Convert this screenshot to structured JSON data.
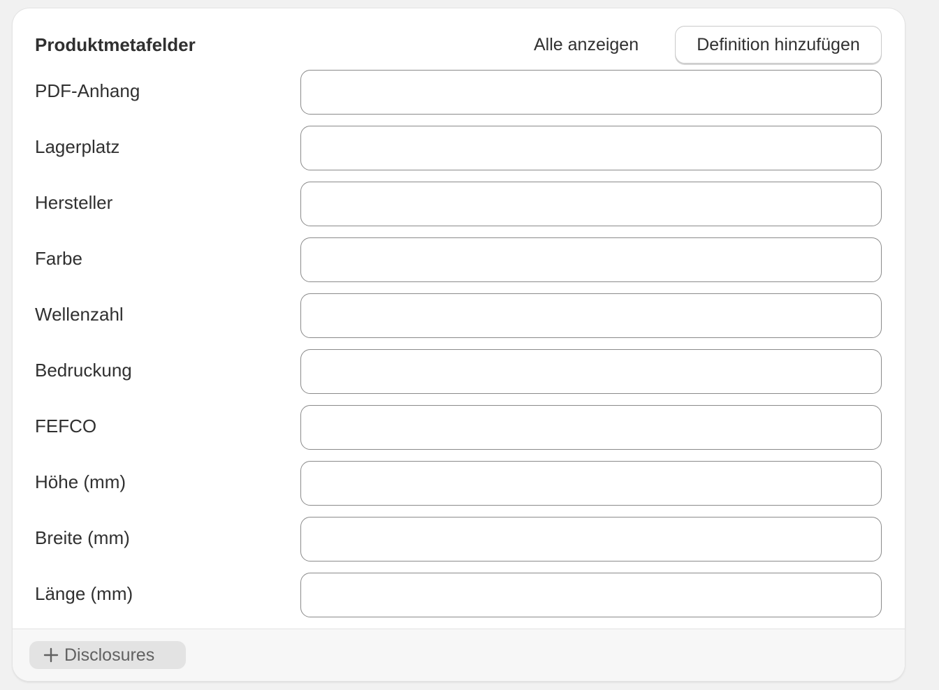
{
  "card": {
    "title": "Produktmetafelder",
    "show_all_label": "Alle anzeigen",
    "add_definition_label": "Definition hinzufügen"
  },
  "fields": [
    {
      "label": "PDF-Anhang",
      "value": ""
    },
    {
      "label": "Lagerplatz",
      "value": ""
    },
    {
      "label": "Hersteller",
      "value": ""
    },
    {
      "label": "Farbe",
      "value": ""
    },
    {
      "label": "Wellenzahl",
      "value": ""
    },
    {
      "label": "Bedruckung",
      "value": ""
    },
    {
      "label": "FEFCO",
      "value": ""
    },
    {
      "label": "Höhe (mm)",
      "value": ""
    },
    {
      "label": "Breite (mm)",
      "value": ""
    },
    {
      "label": "Länge (mm)",
      "value": ""
    }
  ],
  "footer": {
    "disclosure_label": "Disclosures",
    "disclosure_icon": "plus-icon"
  },
  "colors": {
    "background": "#f1f1f1",
    "card": "#ffffff",
    "text": "#303030",
    "input_border": "#8a8a8a",
    "footer_background": "#f7f7f7",
    "disclosure_button": "#e3e3e3",
    "disclosure_text": "#616161"
  }
}
